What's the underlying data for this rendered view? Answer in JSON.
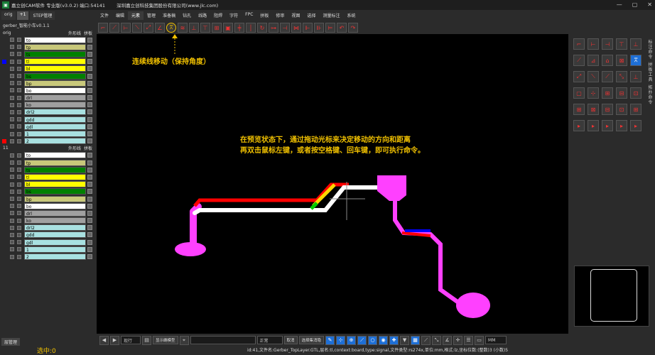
{
  "titlebar": {
    "app_title": "嘉立创CAM软件 专业版(v3.0.2) 端口:54141",
    "company": "深圳嘉立创科技集团股份有限公司(www.jlc.com)",
    "min": "—",
    "max": "▢",
    "close": "✕"
  },
  "menu": [
    "文件",
    "编辑",
    "元素",
    "管理",
    "准备稿",
    "钻孔",
    "线路",
    "阻焊",
    "字符",
    "FPC",
    "拼板",
    "修审",
    "视图",
    "选择",
    "测量标注",
    "系统"
  ],
  "left_panel": {
    "tabs": [
      "orig",
      "+1",
      "STEP管理"
    ],
    "project_name": "gerber_智能小车v0.1.1",
    "groups": [
      {
        "name": "orig",
        "opt1": "外形线",
        "opt2": "拼板",
        "layers": [
          {
            "name": "to",
            "color": "#ffffff",
            "marker": ""
          },
          {
            "name": "tp",
            "color": "#c8c87a",
            "marker": ""
          },
          {
            "name": "ts",
            "color": "#008000",
            "marker": ""
          },
          {
            "name": "tl",
            "color": "#ffff00",
            "marker": "#0000ff"
          },
          {
            "name": "bl",
            "color": "#ffff00",
            "marker": ""
          },
          {
            "name": "bs",
            "color": "#008000",
            "marker": ""
          },
          {
            "name": "bp",
            "color": "#c8c87a",
            "marker": ""
          },
          {
            "name": "bo",
            "color": "#ffffff",
            "marker": ""
          },
          {
            "name": "drl",
            "color": "#a0a0a0",
            "marker": ""
          },
          {
            "name": "ko",
            "color": "#a0a0a0",
            "marker": ""
          },
          {
            "name": "drl2",
            "color": "#a8e0e0",
            "marker": ""
          },
          {
            "name": "gdd",
            "color": "#a8e0e0",
            "marker": ""
          },
          {
            "name": "gdl",
            "color": "#a8e0e0",
            "marker": ""
          },
          {
            "name": "1",
            "color": "#a8e0e0",
            "marker": ""
          },
          {
            "name": "2",
            "color": "#a8e0e0",
            "marker": "#ff0000"
          }
        ]
      },
      {
        "name": "11",
        "opt1": "外形线",
        "opt2": "拼板",
        "layers": [
          {
            "name": "to",
            "color": "#ffffff",
            "marker": ""
          },
          {
            "name": "tp",
            "color": "#c8c87a",
            "marker": ""
          },
          {
            "name": "ts",
            "color": "#008000",
            "marker": ""
          },
          {
            "name": "tl",
            "color": "#ffff00",
            "marker": ""
          },
          {
            "name": "bl",
            "color": "#ffff00",
            "marker": ""
          },
          {
            "name": "bs",
            "color": "#008000",
            "marker": ""
          },
          {
            "name": "bp",
            "color": "#c8c87a",
            "marker": ""
          },
          {
            "name": "bo",
            "color": "#ffffff",
            "marker": ""
          },
          {
            "name": "drl",
            "color": "#a0a0a0",
            "marker": ""
          },
          {
            "name": "ko",
            "color": "#a0a0a0",
            "marker": ""
          },
          {
            "name": "drl2",
            "color": "#a8e0e0",
            "marker": ""
          },
          {
            "name": "gdd",
            "color": "#a8e0e0",
            "marker": ""
          },
          {
            "name": "gdl",
            "color": "#a8e0e0",
            "marker": ""
          },
          {
            "name": "1",
            "color": "#a8e0e0",
            "marker": ""
          },
          {
            "name": "2",
            "color": "#a8e0e0",
            "marker": ""
          }
        ]
      }
    ],
    "bottom_tab": "层管理",
    "selected_count": "选中:0"
  },
  "annotations": {
    "move_label": "连续线移动（保持角度）",
    "instruction_line1": "在预览状态下，通过拖动光标来决定移动的方向和距离",
    "instruction_line2": "再双击鼠标左键，或者按空格键、回车键，即可执行命令。"
  },
  "right_panel": {
    "labels": [
      "标注命令",
      "拼板工具",
      "拓扑命令"
    ]
  },
  "bottombar": {
    "select1": "现行",
    "btn1": "显示确模型",
    "select2": "正常",
    "btn2": "取消",
    "btn3": "选择集消隐",
    "unit": "MM"
  },
  "status": "id:41,文件名:Gerber_TopLayer.GTL,层名:tl,context:board,type:signal,文件类型:rs274x,单位:mm,格式:lz,坐标位数:(整数)3 (小数)5",
  "colors": {
    "trace_magenta": "#ff40ff",
    "trace_red": "#ff0000",
    "trace_white": "#ffffff",
    "trace_blue": "#0000ff",
    "trace_yellow": "#ffd700",
    "trace_green": "#00cc00",
    "accent_yellow": "#f0c000"
  }
}
